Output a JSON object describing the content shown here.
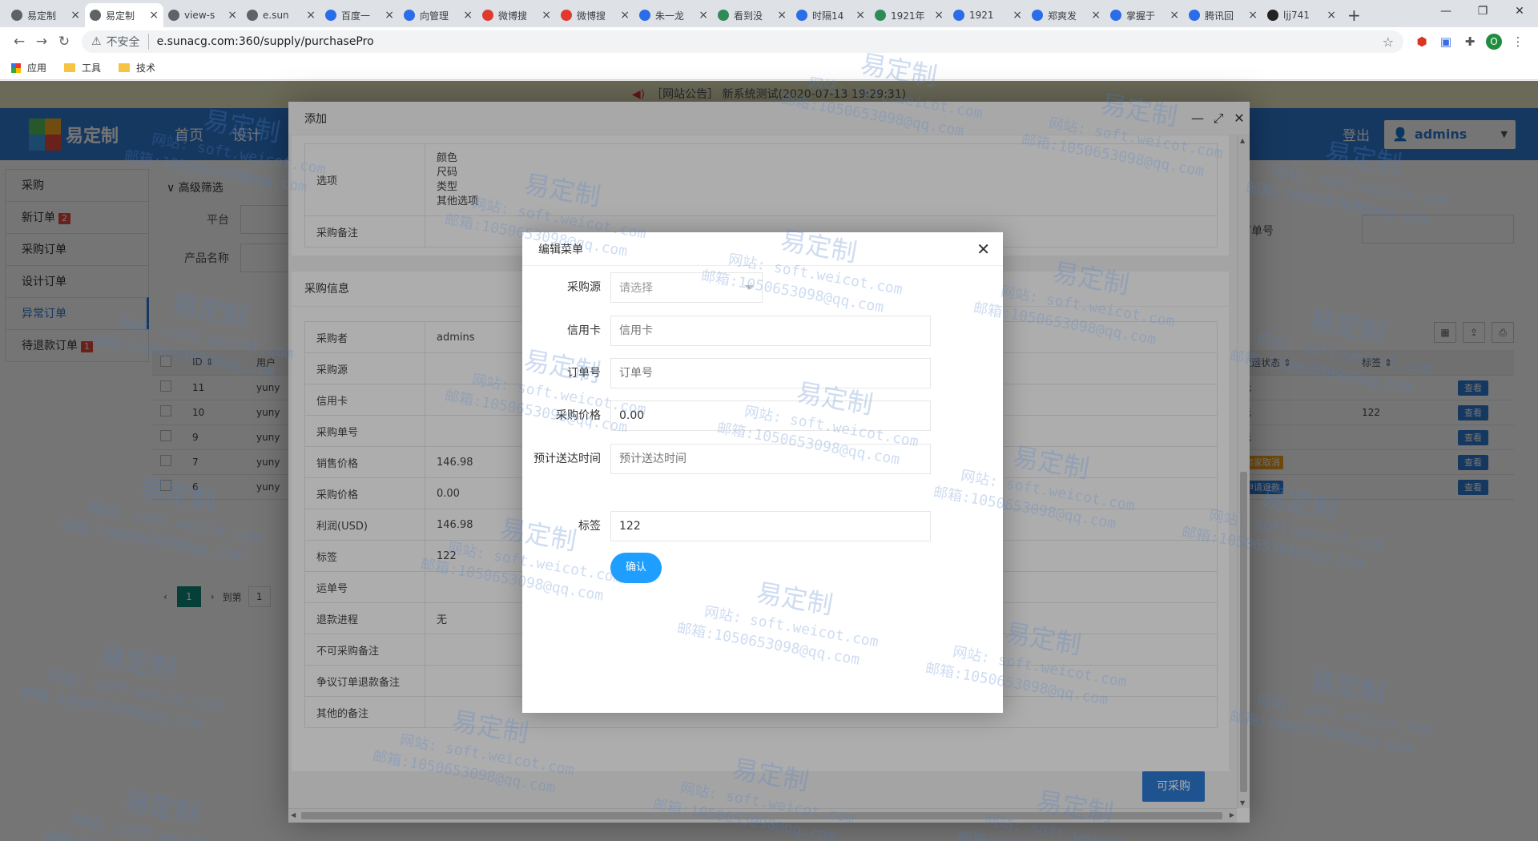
{
  "browser": {
    "tabs": [
      {
        "title": "易定制",
        "icon": "globe-icon",
        "color": "#5f6368",
        "active": false
      },
      {
        "title": "易定制",
        "icon": "globe-icon",
        "color": "#5f6368",
        "active": true
      },
      {
        "title": "view-s",
        "icon": "globe-icon",
        "color": "#5f6368",
        "active": false
      },
      {
        "title": "e.sun",
        "icon": "globe-icon",
        "color": "#5f6368",
        "active": false
      },
      {
        "title": "百度一",
        "icon": "baidu-icon",
        "color": "#2b6de8",
        "active": false
      },
      {
        "title": "向管理",
        "icon": "baidu-icon",
        "color": "#2b6de8",
        "active": false
      },
      {
        "title": "微博搜",
        "icon": "weibo-icon",
        "color": "#e03a2f",
        "active": false
      },
      {
        "title": "微博搜",
        "icon": "weibo-icon",
        "color": "#e03a2f",
        "active": false
      },
      {
        "title": "朱一龙",
        "icon": "baidu-icon",
        "color": "#2b6de8",
        "active": false
      },
      {
        "title": "看到没",
        "icon": "doc-icon",
        "color": "#2e8b57",
        "active": false
      },
      {
        "title": "时隔14",
        "icon": "baidu-icon",
        "color": "#2b6de8",
        "active": false
      },
      {
        "title": "1921年",
        "icon": "doc-icon",
        "color": "#2e8b57",
        "active": false
      },
      {
        "title": "1921",
        "icon": "baidu-icon",
        "color": "#2b6de8",
        "active": false
      },
      {
        "title": "郑爽发",
        "icon": "baidu-icon",
        "color": "#2b6de8",
        "active": false
      },
      {
        "title": "掌握于",
        "icon": "baidu-icon",
        "color": "#2b6de8",
        "active": false
      },
      {
        "title": "腾讯回",
        "icon": "baidu-icon",
        "color": "#2b6de8",
        "active": false
      },
      {
        "title": "ljj741",
        "icon": "github-icon",
        "color": "#222222",
        "active": false
      }
    ],
    "new_tab": "+",
    "window_controls": [
      "—",
      "❐",
      "✕"
    ],
    "insecure_label": "不安全",
    "url": "e.sunacg.com:360/supply/purchasePro",
    "bookmarks": [
      {
        "label": "应用",
        "icon": "apps-icon"
      },
      {
        "label": "工具",
        "icon": "folder-icon"
      },
      {
        "label": "技术",
        "icon": "folder-icon"
      }
    ],
    "account_initial": "O"
  },
  "page": {
    "notice": "［网站公告］ 新系统测试(2020-07-13 19:29:31)",
    "logo_text": "易定制",
    "nav": [
      "首页",
      "设计"
    ],
    "logout": "登出",
    "user": "admins",
    "sidebar": [
      {
        "label": "采购",
        "badge": null,
        "active": false
      },
      {
        "label": "新订单",
        "badge": "2",
        "active": false
      },
      {
        "label": "采购订单",
        "badge": null,
        "active": false
      },
      {
        "label": "设计订单",
        "badge": null,
        "active": false
      },
      {
        "label": "异常订单",
        "badge": null,
        "active": true
      },
      {
        "label": "待退款订单",
        "badge": "1",
        "active": false
      }
    ],
    "filter": {
      "title": "高级筛选",
      "platform_label": "平台",
      "product_label": "产品名称",
      "order_label": "订单号"
    },
    "table": {
      "headers": [
        "ID",
        "用户",
        "货运状态",
        "标签"
      ],
      "rows": [
        {
          "id": "11",
          "user": "yuny",
          "shipping": "无",
          "shipping_tag": null,
          "tag": "",
          "action": "查看"
        },
        {
          "id": "10",
          "user": "yuny",
          "shipping": "无",
          "shipping_tag": null,
          "tag": "122",
          "action": "查看"
        },
        {
          "id": "9",
          "user": "yuny",
          "shipping": "无",
          "shipping_tag": null,
          "tag": "",
          "action": "查看"
        },
        {
          "id": "7",
          "user": "yuny",
          "shipping": "",
          "shipping_tag": "卖家取消",
          "tag": "",
          "action": "查看"
        },
        {
          "id": "6",
          "user": "yuny",
          "shipping": "",
          "shipping_tag": "申请退款",
          "tag": "",
          "action": "查看"
        }
      ]
    },
    "pager": {
      "current": "1",
      "goto": "到第",
      "input": "1"
    }
  },
  "add_layer": {
    "title": "添加",
    "options_label": "选项",
    "options": [
      "颜色",
      "尺码",
      "类型",
      "其他选项"
    ],
    "purchase_note_label": "采购备注",
    "info_title": "采购信息",
    "info_rows": [
      {
        "key": "采购者",
        "value": "admins"
      },
      {
        "key": "采购源",
        "value": ""
      },
      {
        "key": "信用卡",
        "value": ""
      },
      {
        "key": "采购单号",
        "value": ""
      },
      {
        "key": "销售价格",
        "value": "146.98"
      },
      {
        "key": "采购价格",
        "value": "0.00"
      },
      {
        "key": "利润(USD)",
        "value": "146.98"
      },
      {
        "key": "标签",
        "value": "122"
      },
      {
        "key": "运单号",
        "value": ""
      },
      {
        "key": "退款进程",
        "value": "无"
      },
      {
        "key": "不可采购备注",
        "value": ""
      },
      {
        "key": "争议订单退款备注",
        "value": ""
      },
      {
        "key": "其他的备注",
        "value": ""
      }
    ],
    "purchase_button": "可采购"
  },
  "edit_dialog": {
    "title": "编辑菜单",
    "fields": {
      "source": {
        "label": "采购源",
        "placeholder": "请选择"
      },
      "card": {
        "label": "信用卡",
        "placeholder": "信用卡",
        "value": ""
      },
      "order_no": {
        "label": "订单号",
        "placeholder": "订单号",
        "value": ""
      },
      "price": {
        "label": "采购价格",
        "value": "0.00"
      },
      "eta": {
        "label": "预计送达时间",
        "placeholder": "预计送达时间",
        "value": ""
      },
      "tag": {
        "label": "标签",
        "value": "122"
      }
    },
    "confirm": "确认"
  },
  "watermark": {
    "brand": "易定制",
    "site": "网站: soft.weicot.com",
    "email": "邮箱:1050653098@qq.com"
  },
  "colors": {
    "header": "#2f7bd4",
    "confirm": "#1e9fff",
    "badge": "#e54c3c",
    "pager": "#0d8a7a",
    "notice_bg": "#e9e7c1"
  }
}
